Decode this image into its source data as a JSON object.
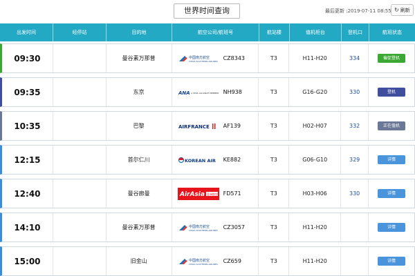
{
  "header": {
    "title": "世界时间查询",
    "last_update_label": "最后更新 :",
    "last_update_value": "2019-07-11 08:55:26",
    "refresh_label": "刷新"
  },
  "columns": [
    "出发时间",
    "经停站",
    "目的地",
    "航空公司/航班号",
    "航站楼",
    "值机柜台",
    "登机口",
    "航班状态"
  ],
  "colors": {
    "header_bg": "#23a9c4",
    "status_boarding_soon": "#3aa832",
    "status_boarding": "#3f4f9e",
    "status_checkin": "#6a7796",
    "status_detail": "#4a94dc",
    "gate_text": "#1c4fa0"
  },
  "flights": [
    {
      "time": "09:30",
      "via": "",
      "dest": "曼谷素万那普",
      "airline": "中国南方航空",
      "flight": "CZ8343",
      "terminal": "T3",
      "counter": "H11-H20",
      "gate": "334",
      "status": "催促登机",
      "status_kind": "boarding_soon"
    },
    {
      "time": "09:35",
      "via": "",
      "dest": "东京",
      "airline": "全日空",
      "flight": "NH938",
      "terminal": "T3",
      "counter": "G16-G20",
      "gate": "330",
      "status": "登机",
      "status_kind": "boarding"
    },
    {
      "time": "10:35",
      "via": "",
      "dest": "巴黎",
      "airline": "AIRFRANCE",
      "flight": "AF139",
      "terminal": "T3",
      "counter": "H02-H07",
      "gate": "332",
      "status": "正在值机",
      "status_kind": "checkin"
    },
    {
      "time": "12:15",
      "via": "",
      "dest": "首尔仁川",
      "airline": "KOREAN AIR",
      "flight": "KE882",
      "terminal": "T3",
      "counter": "G06-G10",
      "gate": "329",
      "status": "详情",
      "status_kind": "detail"
    },
    {
      "time": "12:40",
      "via": "",
      "dest": "曼谷廊曼",
      "airline": "AirAsia",
      "flight": "FD571",
      "terminal": "T3",
      "counter": "H03-H06",
      "gate": "330",
      "status": "详情",
      "status_kind": "detail"
    },
    {
      "time": "14:10",
      "via": "",
      "dest": "曼谷素万那普",
      "airline": "中国南方航空",
      "flight": "CZ3057",
      "terminal": "T3",
      "counter": "H11-H20",
      "gate": "",
      "status": "详情",
      "status_kind": "detail"
    },
    {
      "time": "15:00",
      "via": "",
      "dest": "旧金山",
      "airline": "中国南方航空",
      "flight": "CZ659",
      "terminal": "T3",
      "counter": "H11-H20",
      "gate": "",
      "status": "详情",
      "status_kind": "detail"
    }
  ]
}
